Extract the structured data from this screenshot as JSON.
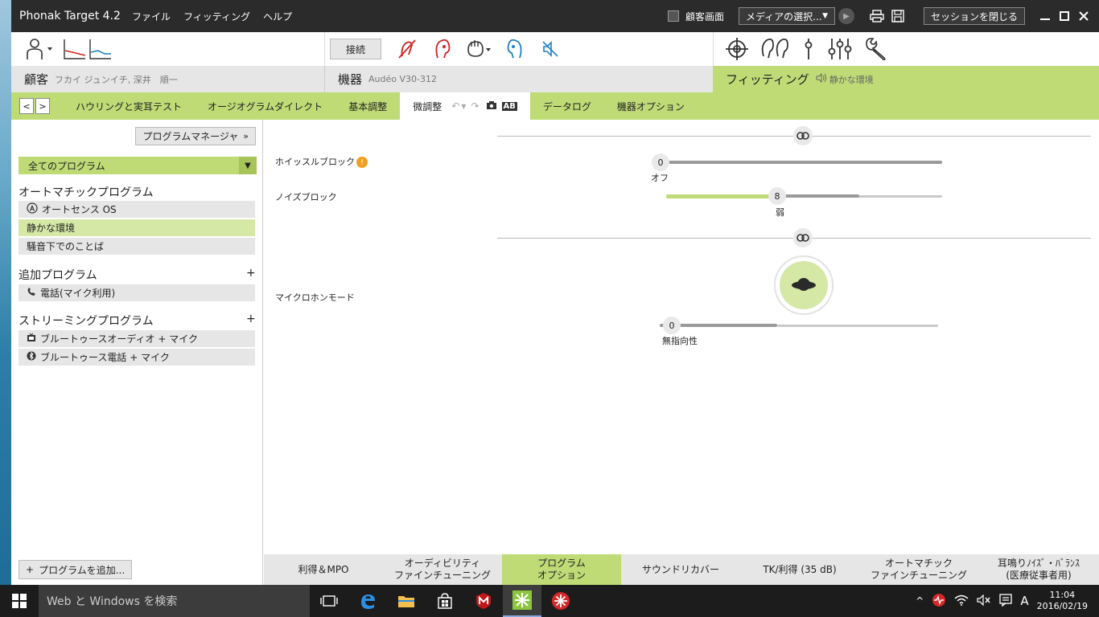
{
  "window": {
    "title": "Phonak Target 4.2",
    "menu": [
      "ファイル",
      "フィッティング",
      "ヘルプ"
    ],
    "client_screen_label": "顧客画面",
    "media_select": "メディアの選択...",
    "close_session": "セッションを閉じる"
  },
  "toolbar": {
    "connect_label": "接続"
  },
  "sections": {
    "client": {
      "title": "顧客",
      "value": "フカイ ジュンイチ, 深井　順一"
    },
    "device": {
      "title": "機器",
      "value": "Audéo V30-312"
    },
    "fitting": {
      "title": "フィッティング",
      "value": "静かな環境"
    }
  },
  "tabs": {
    "items": [
      "ハウリングと実耳テスト",
      "オージオグラムダイレクト",
      "基本調整",
      "微調整",
      "データログ",
      "機器オプション"
    ],
    "active": "微調整",
    "ab_label": "AB"
  },
  "left": {
    "program_manager": "プログラムマネージャ",
    "all_programs": "全てのプログラム",
    "groups": {
      "auto": "オートマチックプログラム",
      "additional": "追加プログラム",
      "streaming": "ストリーミングプログラム"
    },
    "auto_programs": [
      "オートセンス OS",
      "静かな環境",
      "騒音下でのことば"
    ],
    "additional_programs": [
      "電話(マイク利用)"
    ],
    "streaming_programs": [
      "ブルートゥースオーディオ + マイク",
      "ブルートゥース電話 + マイク"
    ],
    "add_program": "プログラムを追加..."
  },
  "controls": {
    "whistle_block": {
      "label": "ホイッスルブロック",
      "value": "0",
      "value_label": "オフ",
      "level": 0
    },
    "noise_block": {
      "label": "ノイズブロック",
      "value": "8",
      "value_label": "弱",
      "level": 0.4
    },
    "mic_mode": {
      "label": "マイクロホンモード",
      "value": "0",
      "value_label": "無指向性",
      "level": 0
    }
  },
  "bottom_tabs": {
    "gain_mpo": "利得＆MPO",
    "aud_fine_1": "オーディビリティ",
    "aud_fine_2": "ファインチューニング",
    "prog_opt_1": "プログラム",
    "prog_opt_2": "オプション",
    "sound_recover": "サウンドリカバー",
    "tk_gain": "TK/利得 (35 dB)",
    "auto_fine_1": "オートマチック",
    "auto_fine_2": "ファインチューニング",
    "tinnitus_1": "耳鳴りﾉｲｽﾞ・ﾊﾞﾗﾝｽ",
    "tinnitus_2": "(医療従事者用)"
  },
  "taskbar": {
    "search_placeholder": "Web と Windows を検索",
    "ime": "A",
    "time": "11:04",
    "date": "2016/02/19"
  },
  "colors": {
    "accent_green": "#bfdb76",
    "warning": "#f0a020",
    "titlebar": "#2b2b2b"
  }
}
